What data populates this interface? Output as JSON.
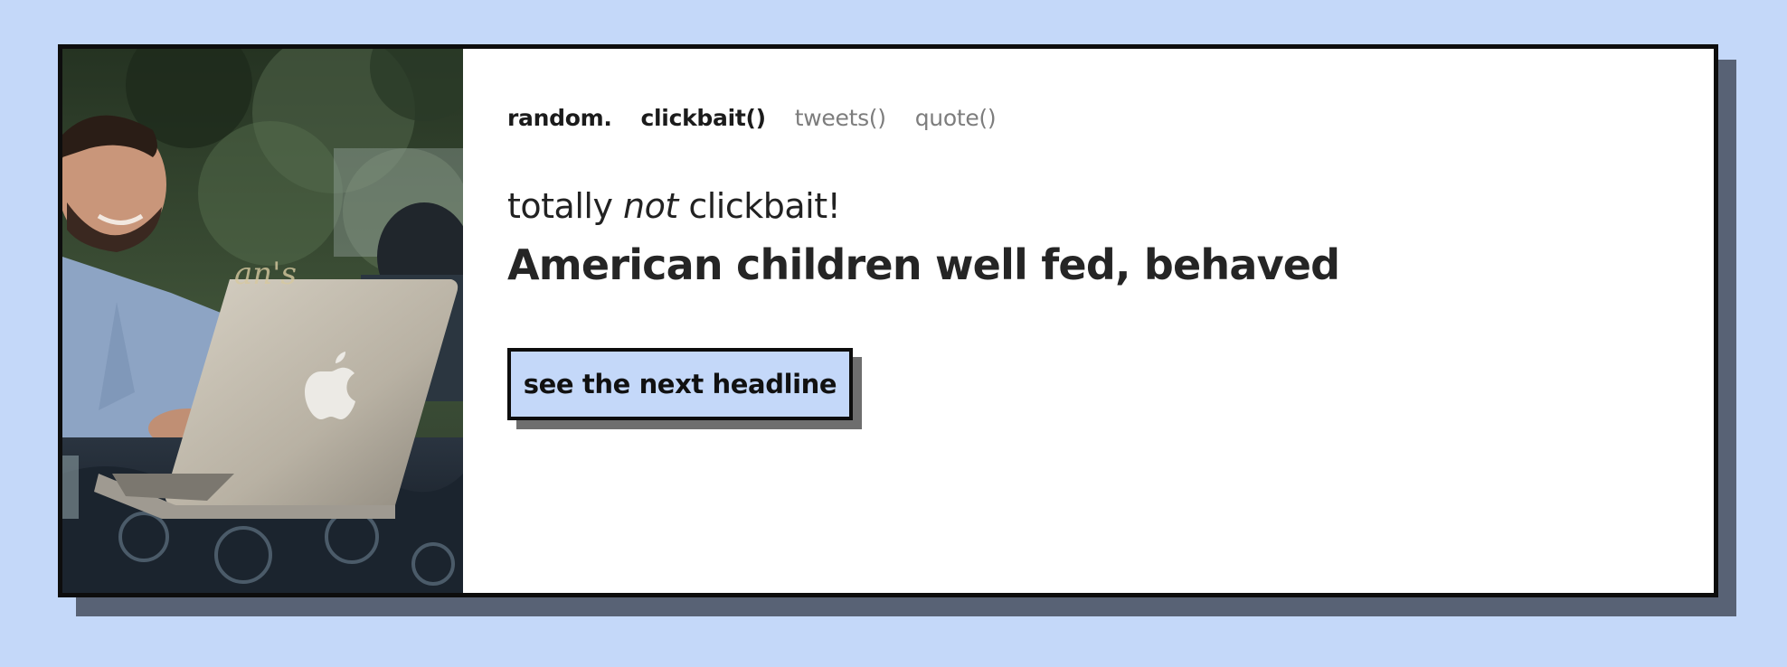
{
  "nav": {
    "brand": "random.",
    "links": [
      {
        "label": "clickbait()",
        "active": true
      },
      {
        "label": "tweets()",
        "active": false
      },
      {
        "label": "quote()",
        "active": false
      }
    ]
  },
  "content": {
    "tagline_prefix": "totally ",
    "tagline_emphasis": "not",
    "tagline_suffix": " clickbait!",
    "headline": "American children well fed, behaved",
    "next_button_label": "see the next headline"
  },
  "photo": {
    "description_icon": "laptop-photo",
    "logo_icon": "apple-logo-icon"
  },
  "colors": {
    "page_background": "#c4d8f9",
    "card_background": "#ffffff",
    "card_border": "#0d0d0d",
    "card_shadow": "#586275",
    "button_background": "#c4d8f9",
    "active_link": "#1b1b1b",
    "inactive_link": "#7d7d7d"
  }
}
